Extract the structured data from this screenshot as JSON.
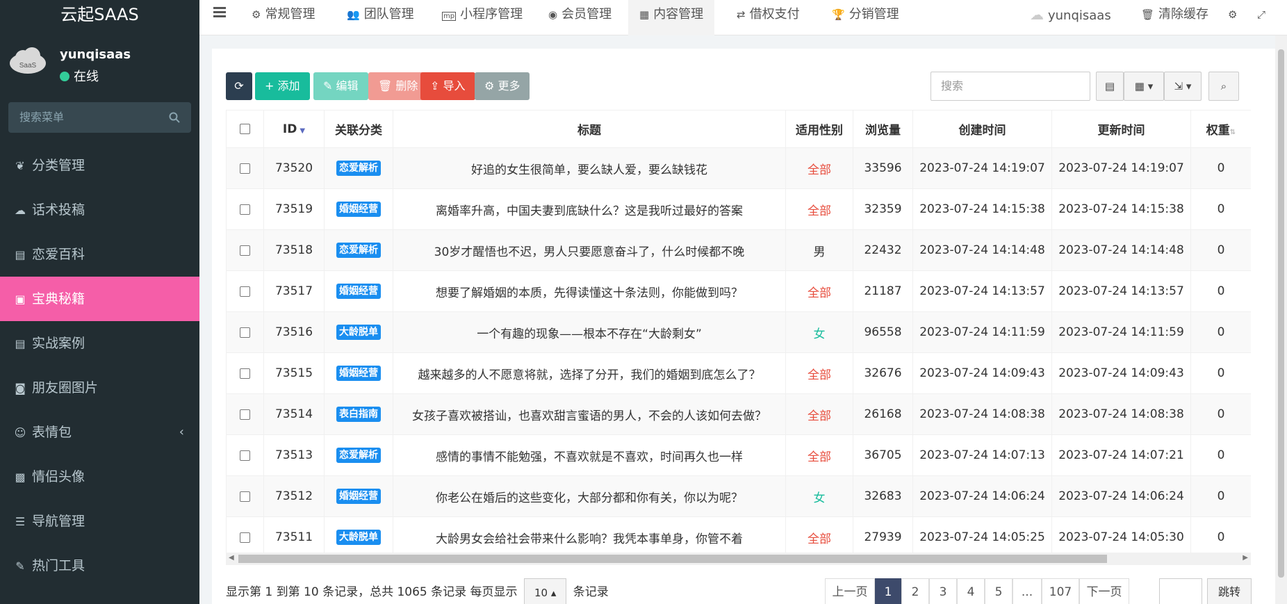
{
  "app": {
    "logo": "云起SAAS",
    "user_name": "yunqisaas",
    "user_status": "在线",
    "avatar_text": "SaaS"
  },
  "sidebar": {
    "search_placeholder": "搜索菜单",
    "items": [
      {
        "label": "分类管理",
        "icon": "leaf-icon"
      },
      {
        "label": "话术投稿",
        "icon": "cloud-upload-icon"
      },
      {
        "label": "恋爱百科",
        "icon": "book-icon"
      },
      {
        "label": "宝典秘籍",
        "icon": "briefcase-icon",
        "active": true
      },
      {
        "label": "实战案例",
        "icon": "book-icon"
      },
      {
        "label": "朋友圈图片",
        "icon": "camera-icon"
      },
      {
        "label": "表情包",
        "icon": "smile-icon"
      },
      {
        "label": "情侣头像",
        "icon": "image-icon"
      },
      {
        "label": "导航管理",
        "icon": "list-icon"
      },
      {
        "label": "热门工具",
        "icon": "tool-icon"
      }
    ]
  },
  "topnav": {
    "items": [
      {
        "label": "常规管理",
        "icon": "cogs-icon"
      },
      {
        "label": "团队管理",
        "icon": "users-icon"
      },
      {
        "label": "小程序管理",
        "icon": "mp-icon"
      },
      {
        "label": "会员管理",
        "icon": "user-circle-icon"
      },
      {
        "label": "内容管理",
        "icon": "newspaper-icon",
        "active": true
      },
      {
        "label": "借权支付",
        "icon": "exchange-icon"
      },
      {
        "label": "分销管理",
        "icon": "trophy-icon"
      }
    ],
    "user": "yunqisaas",
    "clear_cache": "清除缓存"
  },
  "toolbar": {
    "add": "添加",
    "edit": "编辑",
    "delete": "删除",
    "import": "导入",
    "more": "更多",
    "search_placeholder": "搜索"
  },
  "table": {
    "headers": [
      "ID",
      "关联分类",
      "标题",
      "适用性别",
      "浏览量",
      "创建时间",
      "更新时间",
      "权重"
    ],
    "rows": [
      {
        "id": "73520",
        "cat": "恋爱解析",
        "title": "好追的女生很简单，要么缺人爱，要么缺钱花",
        "gender": "全部",
        "views": "33596",
        "created": "2023-07-24 14:19:07",
        "updated": "2023-07-24 14:19:07",
        "weight": "0"
      },
      {
        "id": "73519",
        "cat": "婚姻经营",
        "title": "离婚率升高，中国夫妻到底缺什么？这是我听过最好的答案",
        "gender": "全部",
        "views": "32359",
        "created": "2023-07-24 14:15:38",
        "updated": "2023-07-24 14:15:38",
        "weight": "0"
      },
      {
        "id": "73518",
        "cat": "恋爱解析",
        "title": "30岁才醒悟也不迟，男人只要愿意奋斗了，什么时候都不晚",
        "gender": "男",
        "views": "22432",
        "created": "2023-07-24 14:14:48",
        "updated": "2023-07-24 14:14:48",
        "weight": "0"
      },
      {
        "id": "73517",
        "cat": "婚姻经营",
        "title": "想要了解婚姻的本质，先得读懂这十条法则，你能做到吗？",
        "gender": "全部",
        "views": "21187",
        "created": "2023-07-24 14:13:57",
        "updated": "2023-07-24 14:13:57",
        "weight": "0"
      },
      {
        "id": "73516",
        "cat": "大龄脱单",
        "title": "一个有趣的现象——根本不存在“大龄剩女”",
        "gender": "女",
        "views": "96558",
        "created": "2023-07-24 14:11:59",
        "updated": "2023-07-24 14:11:59",
        "weight": "0"
      },
      {
        "id": "73515",
        "cat": "婚姻经营",
        "title": "越来越多的人不愿意将就，选择了分开，我们的婚姻到底怎么了？",
        "gender": "全部",
        "views": "32676",
        "created": "2023-07-24 14:09:43",
        "updated": "2023-07-24 14:09:43",
        "weight": "0"
      },
      {
        "id": "73514",
        "cat": "表白指南",
        "title": "女孩子喜欢被搭讪，也喜欢甜言蜜语的男人，不会的人该如何去做？",
        "gender": "全部",
        "views": "26168",
        "created": "2023-07-24 14:08:38",
        "updated": "2023-07-24 14:08:38",
        "weight": "0"
      },
      {
        "id": "73513",
        "cat": "恋爱解析",
        "title": "感情的事情不能勉强，不喜欢就是不喜欢，时间再久也一样",
        "gender": "全部",
        "views": "36705",
        "created": "2023-07-24 14:07:13",
        "updated": "2023-07-24 14:07:21",
        "weight": "0"
      },
      {
        "id": "73512",
        "cat": "婚姻经营",
        "title": "你老公在婚后的这些变化，大部分都和你有关，你以为呢？",
        "gender": "女",
        "views": "32683",
        "created": "2023-07-24 14:06:24",
        "updated": "2023-07-24 14:06:24",
        "weight": "0"
      },
      {
        "id": "73511",
        "cat": "大龄脱单",
        "title": "大龄男女会给社会带来什么影响？我凭本事单身，你管不着",
        "gender": "全部",
        "views": "27939",
        "created": "2023-07-24 14:05:25",
        "updated": "2023-07-24 14:05:30",
        "weight": "0"
      }
    ]
  },
  "footer": {
    "info_prefix": "显示第 1 到第 10 条记录，总共 1065 条记录 每页显示",
    "page_size": "10",
    "info_suffix": "条记录",
    "prev": "上一页",
    "pages": [
      "1",
      "2",
      "3",
      "4",
      "5",
      "...",
      "107"
    ],
    "next": "下一页",
    "jump": "跳转"
  },
  "colors": {
    "sidebar_bg": "#222d32",
    "active_pink": "#f55ea8",
    "add_green": "#18bc9c",
    "delete_red": "#e74c3c",
    "tag_blue": "#1a8ef0",
    "pager_active": "#3d4a6b"
  }
}
